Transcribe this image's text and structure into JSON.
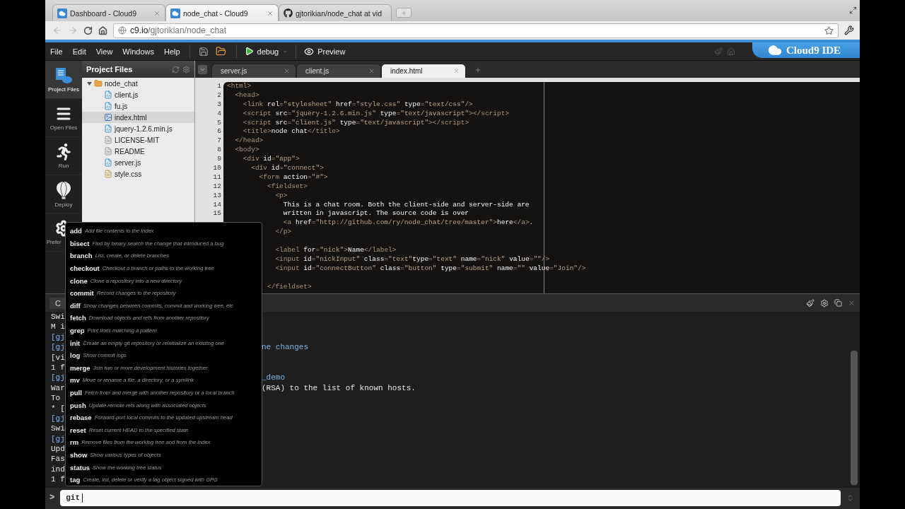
{
  "browser": {
    "tabs": [
      {
        "label": "Dashboard - Cloud9",
        "selected": false,
        "kind": "cloud9"
      },
      {
        "label": "node_chat - Cloud9",
        "selected": true,
        "kind": "cloud9"
      },
      {
        "label": "gjtorikian/node_chat at vid",
        "selected": false,
        "kind": "github"
      }
    ],
    "address": {
      "host": "c9.io",
      "path": "/gjtorikian/node_chat"
    }
  },
  "menubar": {
    "menus": [
      "File",
      "Edit",
      "View",
      "Windows",
      "Help"
    ],
    "run_button": "debug",
    "preview_button": "Preview",
    "logo": "Cloud9 IDE"
  },
  "sidebar": {
    "items": [
      {
        "label": "Project Files",
        "kind": "projects",
        "selected": true
      },
      {
        "label": "Open Files",
        "kind": "files",
        "selected": false
      },
      {
        "label": "Run",
        "kind": "run",
        "selected": false
      },
      {
        "label": "Deploy",
        "kind": "deploy",
        "selected": false
      },
      {
        "label": "Prefer",
        "kind": "preferences",
        "selected": false
      }
    ]
  },
  "project": {
    "title": "Project Files",
    "tree": [
      {
        "name": "node_chat",
        "kind": "folder",
        "expanded": true,
        "selected": false,
        "children": [
          {
            "name": "client.js",
            "kind": "js",
            "selected": false
          },
          {
            "name": "fu.js",
            "kind": "js",
            "selected": false
          },
          {
            "name": "index.html",
            "kind": "html",
            "selected": true
          },
          {
            "name": "jquery-1.2.6.min.js",
            "kind": "js",
            "selected": false
          },
          {
            "name": "LICENSE-MIT",
            "kind": "text",
            "selected": false
          },
          {
            "name": "README",
            "kind": "text",
            "selected": false
          },
          {
            "name": "server.js",
            "kind": "js",
            "selected": false
          },
          {
            "name": "style.css",
            "kind": "css",
            "selected": false
          }
        ]
      }
    ]
  },
  "editor": {
    "tabs": [
      {
        "label": "server.js",
        "selected": false
      },
      {
        "label": "client.js",
        "selected": false
      },
      {
        "label": "index.html",
        "selected": true
      }
    ],
    "lines": [
      {
        "kind": "code",
        "n": "1",
        "tokens": [
          {
            "kind": "tag",
            "text": "<html>"
          }
        ]
      },
      {
        "kind": "code",
        "n": "2",
        "tokens": [
          {
            "kind": "tag",
            "text": "  <head>"
          }
        ]
      },
      {
        "kind": "code",
        "n": "3",
        "tokens": [
          {
            "kind": "tag",
            "text": "    <link "
          },
          {
            "kind": "attr",
            "text": "rel"
          },
          {
            "kind": "tag",
            "text": "="
          },
          {
            "kind": "str",
            "text": "\"stylesheet\""
          },
          {
            "kind": "attr",
            "text": " href"
          },
          {
            "kind": "tag",
            "text": "="
          },
          {
            "kind": "str",
            "text": "\"style.css\""
          },
          {
            "kind": "attr",
            "text": " type"
          },
          {
            "kind": "tag",
            "text": "="
          },
          {
            "kind": "str",
            "text": "\"text/css\""
          },
          {
            "kind": "tag",
            "text": "/>"
          }
        ]
      },
      {
        "kind": "code",
        "n": "4",
        "tokens": [
          {
            "kind": "tag",
            "text": "    <script "
          },
          {
            "kind": "attr",
            "text": "src"
          },
          {
            "kind": "tag",
            "text": "="
          },
          {
            "kind": "str",
            "text": "\"jquery-1.2.6.min.js\""
          },
          {
            "kind": "attr",
            "text": " type"
          },
          {
            "kind": "tag",
            "text": "="
          },
          {
            "kind": "str",
            "text": "\"text/javascript\""
          },
          {
            "kind": "tag",
            "text": "></script>"
          }
        ]
      },
      {
        "kind": "code",
        "n": "5",
        "tokens": [
          {
            "kind": "tag",
            "text": "    <script "
          },
          {
            "kind": "attr",
            "text": "src"
          },
          {
            "kind": "tag",
            "text": "="
          },
          {
            "kind": "str",
            "text": "\"client.js\""
          },
          {
            "kind": "attr",
            "text": " type"
          },
          {
            "kind": "tag",
            "text": "="
          },
          {
            "kind": "str",
            "text": "\"text/javascript\""
          },
          {
            "kind": "tag",
            "text": "></script>"
          }
        ]
      },
      {
        "kind": "code",
        "n": "6",
        "tokens": [
          {
            "kind": "tag",
            "text": "    <title>"
          },
          {
            "kind": "text",
            "text": "node chat"
          },
          {
            "kind": "tag",
            "text": "</title>"
          }
        ]
      },
      {
        "kind": "code",
        "n": "7",
        "tokens": [
          {
            "kind": "tag",
            "text": "  </head>"
          }
        ]
      },
      {
        "kind": "code",
        "n": "8",
        "tokens": [
          {
            "kind": "tag",
            "text": "  <body>"
          }
        ]
      },
      {
        "kind": "code",
        "n": "9",
        "tokens": [
          {
            "kind": "tag",
            "text": "    <div "
          },
          {
            "kind": "attr",
            "text": "id"
          },
          {
            "kind": "tag",
            "text": "="
          },
          {
            "kind": "str",
            "text": "\"app\""
          },
          {
            "kind": "tag",
            "text": ">"
          }
        ]
      },
      {
        "kind": "code",
        "n": "10",
        "tokens": [
          {
            "kind": "tag",
            "text": "      <div "
          },
          {
            "kind": "attr",
            "text": "id"
          },
          {
            "kind": "tag",
            "text": "="
          },
          {
            "kind": "str",
            "text": "\"connect\""
          },
          {
            "kind": "tag",
            "text": ">"
          }
        ]
      },
      {
        "kind": "code",
        "n": "11",
        "tokens": [
          {
            "kind": "tag",
            "text": "        <form "
          },
          {
            "kind": "attr",
            "text": "action"
          },
          {
            "kind": "tag",
            "text": "="
          },
          {
            "kind": "str",
            "text": "\"#\""
          },
          {
            "kind": "tag",
            "text": ">"
          }
        ]
      },
      {
        "kind": "code",
        "n": "12",
        "tokens": [
          {
            "kind": "tag",
            "text": "          <fieldset>"
          }
        ]
      },
      {
        "kind": "code",
        "n": "13",
        "tokens": [
          {
            "kind": "tag",
            "text": "            <p>"
          }
        ]
      },
      {
        "kind": "code",
        "n": "14",
        "tokens": [
          {
            "kind": "text",
            "text": "              This is a chat room. Both the client-side and server-side are"
          }
        ]
      },
      {
        "kind": "code",
        "n": "15",
        "tokens": [
          {
            "kind": "text",
            "text": "              written in javascript. The source code is over"
          }
        ]
      },
      {
        "kind": "code",
        "tokens": [
          {
            "kind": "tag",
            "text": "              <a "
          },
          {
            "kind": "attr",
            "text": "href"
          },
          {
            "kind": "tag",
            "text": "="
          },
          {
            "kind": "str",
            "text": "\"http://github.com/ry/node_chat/tree/master\""
          },
          {
            "kind": "tag",
            "text": ">"
          },
          {
            "kind": "text",
            "text": "here"
          },
          {
            "kind": "tag",
            "text": "</a>"
          },
          {
            "kind": "text",
            "text": "."
          }
        ]
      },
      {
        "kind": "code",
        "tokens": [
          {
            "kind": "tag",
            "text": "            </p>"
          }
        ]
      },
      {
        "kind": "blank"
      },
      {
        "kind": "code",
        "tokens": [
          {
            "kind": "tag",
            "text": "            <label "
          },
          {
            "kind": "attr",
            "text": "for"
          },
          {
            "kind": "tag",
            "text": "="
          },
          {
            "kind": "str",
            "text": "\"nick\""
          },
          {
            "kind": "tag",
            "text": ">"
          },
          {
            "kind": "text",
            "text": "Name"
          },
          {
            "kind": "tag",
            "text": "</label>"
          }
        ]
      },
      {
        "kind": "code",
        "tokens": [
          {
            "kind": "tag",
            "text": "            <input "
          },
          {
            "kind": "attr",
            "text": "id"
          },
          {
            "kind": "tag",
            "text": "="
          },
          {
            "kind": "str",
            "text": "\"nickInput\""
          },
          {
            "kind": "attr",
            "text": " class"
          },
          {
            "kind": "tag",
            "text": "="
          },
          {
            "kind": "str",
            "text": "\"text\""
          },
          {
            "kind": "attr",
            "text": "type"
          },
          {
            "kind": "tag",
            "text": "="
          },
          {
            "kind": "str",
            "text": "\"text\""
          },
          {
            "kind": "attr",
            "text": " name"
          },
          {
            "kind": "tag",
            "text": "="
          },
          {
            "kind": "str",
            "text": "\"nick\""
          },
          {
            "kind": "attr",
            "text": " value"
          },
          {
            "kind": "tag",
            "text": "="
          },
          {
            "kind": "str",
            "text": "\"\""
          },
          {
            "kind": "tag",
            "text": "/>"
          }
        ]
      },
      {
        "kind": "code",
        "tokens": [
          {
            "kind": "tag",
            "text": "            <input "
          },
          {
            "kind": "attr",
            "text": "id"
          },
          {
            "kind": "tag",
            "text": "="
          },
          {
            "kind": "str",
            "text": "\"connectButton\""
          },
          {
            "kind": "attr",
            "text": " class"
          },
          {
            "kind": "tag",
            "text": "="
          },
          {
            "kind": "str",
            "text": "\"button\""
          },
          {
            "kind": "attr",
            "text": " type"
          },
          {
            "kind": "tag",
            "text": "="
          },
          {
            "kind": "str",
            "text": "\"submit\""
          },
          {
            "kind": "attr",
            "text": " name"
          },
          {
            "kind": "tag",
            "text": "="
          },
          {
            "kind": "str",
            "text": "\"\""
          },
          {
            "kind": "attr",
            "text": " value"
          },
          {
            "kind": "tag",
            "text": "="
          },
          {
            "kind": "str",
            "text": "\"Join\""
          },
          {
            "kind": "tag",
            "text": "/>"
          }
        ]
      },
      {
        "kind": "blank"
      },
      {
        "kind": "code",
        "tokens": [
          {
            "kind": "tag",
            "text": "          </fieldset>"
          }
        ]
      }
    ]
  },
  "console": {
    "tab": "C",
    "lines": [
      {
        "kind": "output",
        "left": "Swi"
      },
      {
        "kind": "output",
        "left": "M i"
      },
      {
        "kind": "prompt",
        "left": "[gj"
      },
      {
        "kind": "prompt",
        "left": "[gj",
        "right": "ne changes"
      },
      {
        "kind": "output",
        "left": "[vi"
      },
      {
        "kind": "output",
        "left": "1 f"
      },
      {
        "kind": "prompt",
        "left": "[gj",
        "right": "_demo"
      },
      {
        "kind": "output",
        "left": "War",
        "right": "(RSA) to the list of known hosts."
      },
      {
        "kind": "output",
        "left": "To "
      },
      {
        "kind": "output",
        "left": "* ["
      },
      {
        "kind": "prompt",
        "left": "[gj"
      },
      {
        "kind": "output",
        "left": "Swi"
      },
      {
        "kind": "prompt",
        "left": "[gj"
      },
      {
        "kind": "output",
        "left": "Upd"
      },
      {
        "kind": "output",
        "left": "Fas"
      },
      {
        "kind": "output",
        "left": "ind"
      },
      {
        "kind": "output",
        "left": "1 f"
      }
    ]
  },
  "command_line": {
    "prompt": ">",
    "value": "git"
  },
  "completion": {
    "items": [
      {
        "name": "add",
        "desc": "Add file contents to the index"
      },
      {
        "name": "bisect",
        "desc": "Find by binary search the change that introduced a bug"
      },
      {
        "name": "branch",
        "desc": "List, create, or delete branches"
      },
      {
        "name": "checkout",
        "desc": "Checkout a branch or paths to the working tree"
      },
      {
        "name": "clone",
        "desc": "Clone a repository into a new directory"
      },
      {
        "name": "commit",
        "desc": "Record changes to the repository"
      },
      {
        "name": "diff",
        "desc": "Show changes between commits, commit and working tree, etc"
      },
      {
        "name": "fetch",
        "desc": "Download objects and refs from another repository"
      },
      {
        "name": "grep",
        "desc": "Print lines matching a pattern"
      },
      {
        "name": "init",
        "desc": "Create an empty git repository or reinitialize an existing one"
      },
      {
        "name": "log",
        "desc": "Show commit logs"
      },
      {
        "name": "merge",
        "desc": "Join two or more development histories together"
      },
      {
        "name": "mv",
        "desc": "Move or rename a file, a directory, or a symlink"
      },
      {
        "name": "pull",
        "desc": "Fetch from and merge with another repository or a local branch"
      },
      {
        "name": "push",
        "desc": "Update remote refs along with associated objects"
      },
      {
        "name": "rebase",
        "desc": "Forward-port local commits to the updated upstream head"
      },
      {
        "name": "reset",
        "desc": "Reset current HEAD to the specified state"
      },
      {
        "name": "rm",
        "desc": "Remove files from the working tree and from the index"
      },
      {
        "name": "show",
        "desc": "Show various types of objects"
      },
      {
        "name": "status",
        "desc": "Show the working tree status"
      },
      {
        "name": "tag",
        "desc": "Create, list, delete or verify a tag object signed with GPG"
      }
    ]
  }
}
